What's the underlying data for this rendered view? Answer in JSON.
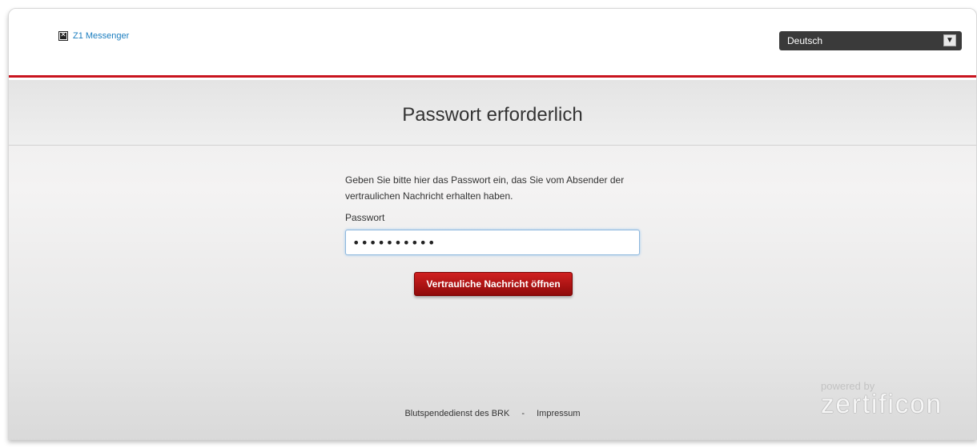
{
  "header": {
    "brand_label": "Z1 Messenger",
    "language": {
      "selected": "Deutsch"
    }
  },
  "main": {
    "title": "Passwort erforderlich",
    "instructions": "Geben Sie bitte hier das Passwort ein, das Sie vom Absender der vertraulichen Nachricht erhalten haben.",
    "password_label": "Passwort",
    "password_value": "••••••••••",
    "submit_label": "Vertrauliche Nachricht öffnen"
  },
  "footer": {
    "link1": "Blutspendedienst des BRK",
    "separator": "-",
    "link2": "Impressum"
  },
  "powered": {
    "caption": "powered by",
    "logo": "zertificon"
  },
  "colors": {
    "accent_red": "#c8141e",
    "link_blue": "#1a7dbf",
    "dropdown_bg": "#3a3a3a"
  },
  "icons": {
    "brand": "broken-image-icon",
    "dropdown": "chevron-down-icon"
  }
}
